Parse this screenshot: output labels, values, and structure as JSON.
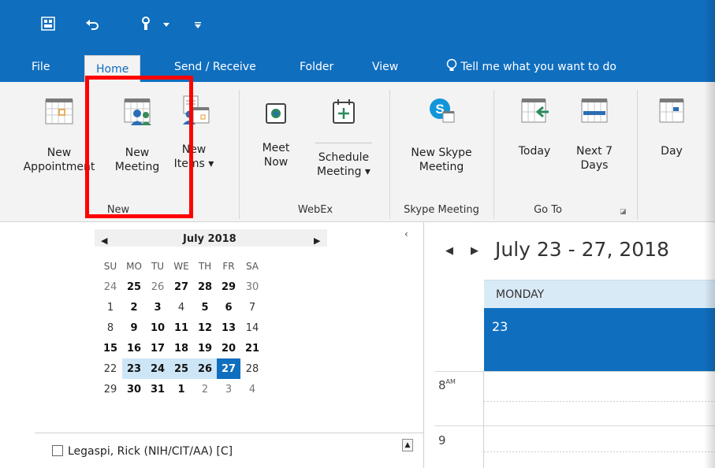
{
  "quick_access": {
    "save_icon": "outlook-save-icon",
    "undo_icon": "undo-icon",
    "touch_icon": "touch-mode-icon",
    "customize_icon": "customize-qat-icon"
  },
  "tabs": [
    "File",
    "Home",
    "Send / Receive",
    "Folder",
    "View"
  ],
  "tell_me": {
    "icon": "lightbulb-icon",
    "label": "Tell me what you want to do"
  },
  "ribbon": {
    "new_appointment": [
      "New",
      "Appointment"
    ],
    "new_meeting": [
      "New",
      "Meeting"
    ],
    "new_items": [
      "New",
      "Items"
    ],
    "group_new": "New",
    "meet_now": [
      "Meet",
      "Now"
    ],
    "schedule_meeting": [
      "Schedule",
      "Meeting"
    ],
    "group_webex": "WebEx",
    "new_skype_meeting": [
      "New Skype",
      "Meeting"
    ],
    "group_skype": "Skype Meeting",
    "today": "Today",
    "next7": [
      "Next 7",
      "Days"
    ],
    "group_goto": "Go To",
    "day": "Day"
  },
  "mini_calendar": {
    "month": "July 2018",
    "prev": "◀",
    "next": "▶",
    "weekdays": [
      "SU",
      "MO",
      "TU",
      "WE",
      "TH",
      "FR",
      "SA"
    ],
    "rows": [
      [
        "24",
        "25",
        "26",
        "27",
        "28",
        "29",
        "30"
      ],
      [
        "1",
        "2",
        "3",
        "4",
        "5",
        "6",
        "7"
      ],
      [
        "8",
        "9",
        "10",
        "11",
        "12",
        "13",
        "14"
      ],
      [
        "15",
        "16",
        "17",
        "18",
        "19",
        "20",
        "21"
      ],
      [
        "22",
        "23",
        "24",
        "25",
        "26",
        "27",
        "28"
      ],
      [
        "29",
        "30",
        "31",
        "1",
        "2",
        "3",
        "4"
      ]
    ]
  },
  "folder": {
    "label": "Legaspi, Rick (NIH/CIT/AA) [C]"
  },
  "calendar_view": {
    "collapse": "‹",
    "nav_prev": "◀",
    "nav_next": "▶",
    "range": "July 23 - 27, 2018",
    "day_header": "MONDAY",
    "day_number": "23",
    "hours": [
      {
        "hour": "8",
        "suffix": "AM"
      },
      {
        "hour": "9",
        "suffix": ""
      }
    ]
  },
  "colors": {
    "accent": "#106ebe",
    "highlight": "#ff0000",
    "week_row": "#cde6f7"
  }
}
